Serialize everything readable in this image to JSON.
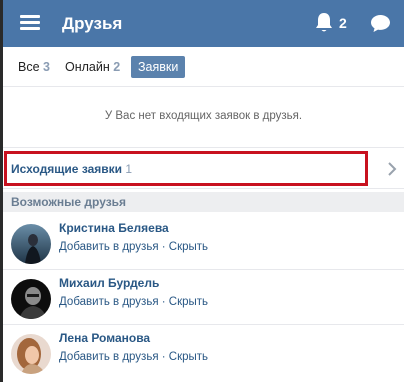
{
  "header": {
    "title": "Друзья",
    "notifications_count": "2"
  },
  "tabs": [
    {
      "label": "Все",
      "count": "3"
    },
    {
      "label": "Онлайн",
      "count": "2"
    },
    {
      "label": "Заявки",
      "count": ""
    }
  ],
  "empty_message": "У Вас нет входящих заявок в друзья.",
  "outgoing": {
    "label": "Исходящие заявки",
    "count": "1"
  },
  "suggestions": {
    "header": "Возможные друзья",
    "add_label": "Добавить в друзья",
    "separator": " · ",
    "hide_label": "Скрыть",
    "items": [
      {
        "name": "Кристина Беляева"
      },
      {
        "name": "Михаил Бурдель"
      },
      {
        "name": "Лена Романова"
      }
    ]
  },
  "colors": {
    "topbar": "#4a76a8",
    "link": "#2a5885",
    "highlight": "#c8111f"
  }
}
